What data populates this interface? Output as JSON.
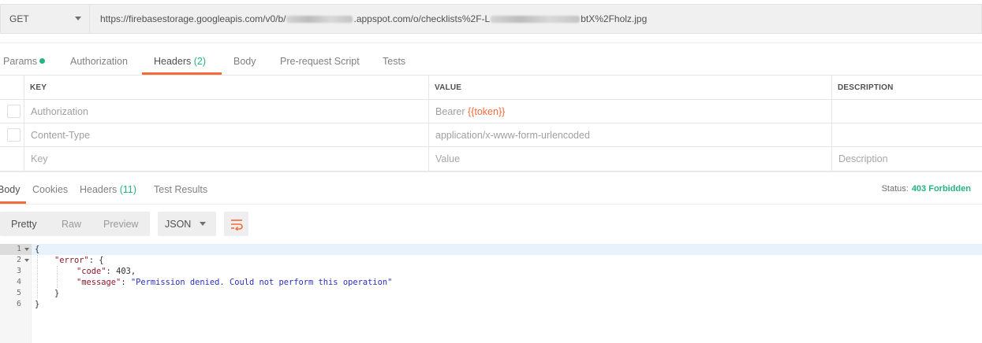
{
  "request": {
    "method": "GET",
    "url_prefix": "https://firebasestorage.googleapis.com/v0/b/",
    "url_middle": ".appspot.com/o/checklists%2F-L",
    "url_suffix": "btX%2Fholz.jpg"
  },
  "request_tabs": [
    {
      "label": "Params"
    },
    {
      "label": "Authorization"
    },
    {
      "label": "Headers",
      "count": "(2)"
    },
    {
      "label": "Body"
    },
    {
      "label": "Pre-request Script"
    },
    {
      "label": "Tests"
    }
  ],
  "headers_table": {
    "columns": [
      "KEY",
      "VALUE",
      "DESCRIPTION"
    ],
    "rows": [
      {
        "key": "Authorization",
        "value_prefix": "Bearer ",
        "value_token": "{{token}}",
        "description": ""
      },
      {
        "key": "Content-Type",
        "value": "application/x-www-form-urlencoded",
        "description": ""
      }
    ],
    "placeholders": {
      "key": "Key",
      "value": "Value",
      "description": "Description"
    }
  },
  "response_tabs": [
    {
      "label": "Body"
    },
    {
      "label": "Cookies"
    },
    {
      "label": "Headers",
      "count": "(11)"
    },
    {
      "label": "Test Results"
    }
  ],
  "status": {
    "label": "Status:",
    "value": "403 Forbidden",
    "color": "#26b47f"
  },
  "body_view": {
    "modes": [
      "Pretty",
      "Raw",
      "Preview"
    ],
    "active_mode": "Pretty",
    "format": "JSON",
    "wrap_icon": "wrap-lines-icon"
  },
  "response_body": {
    "line_numbers": [
      "1",
      "2",
      "3",
      "4",
      "5",
      "6"
    ],
    "open_brace": "{",
    "error_key": "\"error\"",
    "error_open": ": {",
    "code_key": "\"code\"",
    "code_sep": ": ",
    "code_value": "403",
    "code_comma": ",",
    "message_key": "\"message\"",
    "message_sep": ": ",
    "message_value": "\"Permission denied. Could not perform this operation\"",
    "inner_close": "}",
    "outer_close": "}"
  },
  "colors": {
    "accent": "#f26b3a",
    "success": "#26b47f"
  }
}
